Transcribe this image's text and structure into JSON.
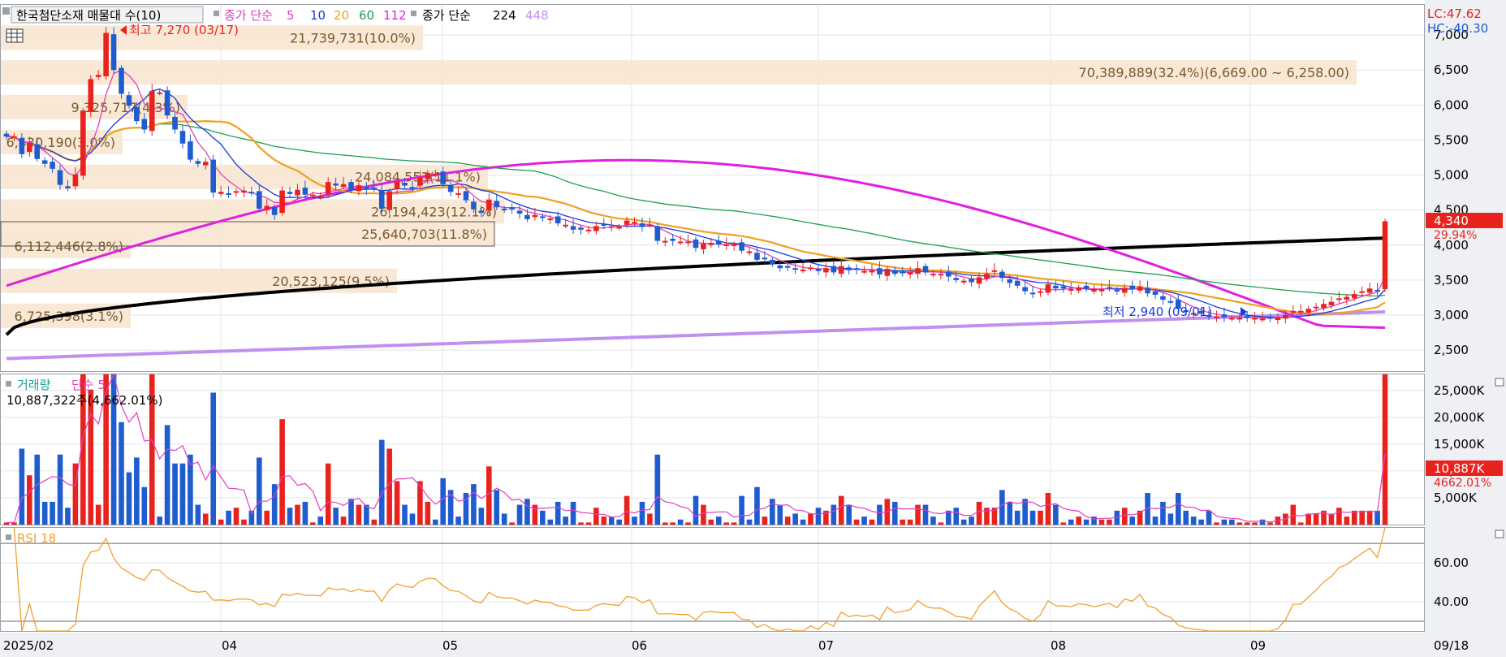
{
  "header": {
    "title": "한국첨단소재 매물대 수(10)",
    "ma_label": "종가 단순",
    "ma_periods": [
      "5",
      "10",
      "20",
      "60",
      "112"
    ],
    "ma2_label": "종가 단순",
    "ma2_periods": [
      "224",
      "448"
    ]
  },
  "price_panel": {
    "high_label": "최고 7,270 (03/17)",
    "low_label": "최저 2,940 (09/01)",
    "lc_label": "LC:47.62",
    "hc_label": "HC:-40.30",
    "current_price": "4,340",
    "current_change": "29.94%",
    "y_ticks": [
      "7,000",
      "6,500",
      "6,000",
      "5,500",
      "5,000",
      "4,500",
      "4,000",
      "3,500",
      "3,000",
      "2,500"
    ],
    "y_range": [
      2200,
      7430
    ]
  },
  "volume_profile": [
    {
      "label": "21,739,731(10.0%)",
      "price": 6960
    },
    {
      "label": "70,389,889(32.4%)(6,669.00 ~ 6,258.00)",
      "price": 6465
    },
    {
      "label": "9,325,717(4.3%)",
      "price": 5970
    },
    {
      "label": "6,430,190(3.0%)",
      "price": 5470
    },
    {
      "label": "24,084,553(11.1%)",
      "price": 4975
    },
    {
      "label": "26,194,423(12.1%)",
      "price": 4480
    },
    {
      "label": "25,640,703(11.8%)",
      "price": 4160
    },
    {
      "label": "6,112,446(2.8%)",
      "price": 3985
    },
    {
      "label": "20,523,125(9.5%)",
      "price": 3490
    },
    {
      "label": "6,725,398(3.1%)",
      "price": 2990
    }
  ],
  "volume_panel": {
    "title": "거래량",
    "ma_label": "단순 5",
    "max_label": "10,887,322주(4,662.01%)",
    "current_volume": "10,887K",
    "current_ratio": "4662.01%",
    "y_ticks": [
      "25,000K",
      "20,000K",
      "15,000K",
      "10,000K",
      "5,000K"
    ]
  },
  "rsi_panel": {
    "title": "RSI 18",
    "y_ticks": [
      "60.00",
      "40.00"
    ]
  },
  "x_axis": {
    "labels": [
      "2025/02",
      "04",
      "05",
      "06",
      "07",
      "08",
      "09"
    ],
    "last_date": "09/18"
  },
  "colors": {
    "up": "#e8231e",
    "down": "#1e5cd0",
    "ma5": "#e040c0",
    "ma10": "#1a3ad8",
    "ma20": "#f0a020",
    "ma60": "#1ea050",
    "ma112": "#e020e0",
    "ma224": "#000000",
    "ma448": "#c090f0",
    "profile": "#f7e6d0",
    "rsi": "#f0a030"
  },
  "chart_data": {
    "type": "candlestick",
    "closes": [
      5550,
      5550,
      5300,
      5460,
      5230,
      5160,
      5090,
      4860,
      4810,
      5010,
      5920,
      6370,
      6430,
      7030,
      6500,
      6160,
      5990,
      5770,
      5650,
      6200,
      6180,
      5850,
      5650,
      5450,
      5220,
      5160,
      5190,
      4750,
      4760,
      4720,
      4770,
      4780,
      4740,
      4520,
      4560,
      4430,
      4780,
      4730,
      4790,
      4720,
      4720,
      4700,
      4900,
      4850,
      4870,
      4790,
      4850,
      4790,
      4800,
      4520,
      4770,
      4910,
      4850,
      4820,
      4960,
      5030,
      5020,
      4870,
      4760,
      4740,
      4640,
      4510,
      4460,
      4650,
      4540,
      4510,
      4510,
      4450,
      4370,
      4430,
      4390,
      4380,
      4310,
      4290,
      4220,
      4220,
      4220,
      4270,
      4290,
      4270,
      4260,
      4350,
      4330,
      4260,
      4290,
      4060,
      4060,
      4060,
      4050,
      4050,
      3960,
      4020,
      4030,
      4010,
      4010,
      4010,
      3920,
      3910,
      3790,
      3810,
      3730,
      3670,
      3690,
      3660,
      3650,
      3680,
      3630,
      3670,
      3610,
      3700,
      3640,
      3650,
      3630,
      3640,
      3580,
      3660,
      3590,
      3600,
      3610,
      3670,
      3610,
      3590,
      3590,
      3550,
      3500,
      3490,
      3470,
      3540,
      3590,
      3640,
      3530,
      3460,
      3420,
      3340,
      3300,
      3340,
      3440,
      3380,
      3380,
      3370,
      3390,
      3380,
      3360,
      3370,
      3380,
      3340,
      3390,
      3370,
      3410,
      3310,
      3290,
      3220,
      3190,
      3090,
      3050,
      3030,
      3020,
      2980,
      2980,
      2970,
      2960,
      2960,
      2960,
      2960,
      2950,
      2950,
      2970,
      3000,
      3060,
      3060,
      3090,
      3120,
      3160,
      3190,
      3240,
      3260,
      3300,
      3340,
      3380,
      3340,
      4340
    ],
    "rsi_range": [
      25,
      78
    ],
    "volume_ticks": [
      25000,
      20000,
      15000,
      10000,
      5000
    ],
    "volume_range_K": [
      0,
      28000
    ]
  }
}
